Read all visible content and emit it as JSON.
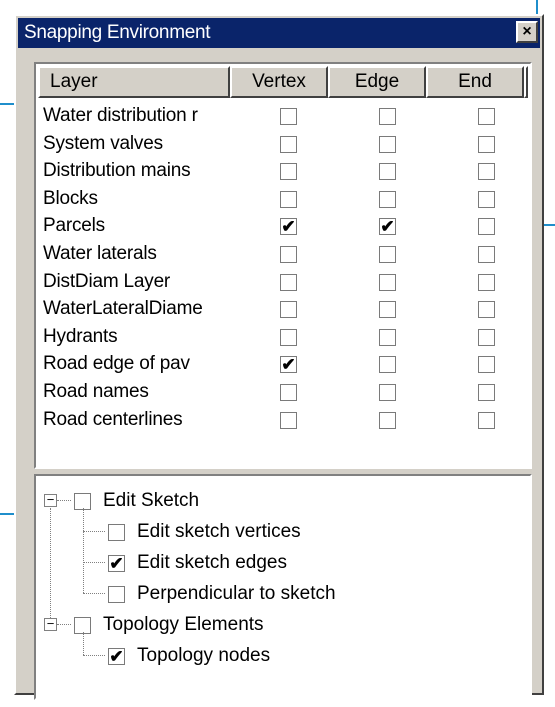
{
  "window": {
    "title": "Snapping Environment",
    "close_label": "×"
  },
  "table": {
    "headers": {
      "layer": "Layer",
      "vertex": "Vertex",
      "edge": "Edge",
      "end": "End"
    },
    "rows": [
      {
        "name": "Water distribution r",
        "vertex": false,
        "edge": false,
        "end": false
      },
      {
        "name": "System valves",
        "vertex": false,
        "edge": false,
        "end": false
      },
      {
        "name": "Distribution mains",
        "vertex": false,
        "edge": false,
        "end": false
      },
      {
        "name": "Blocks",
        "vertex": false,
        "edge": false,
        "end": false
      },
      {
        "name": "Parcels",
        "vertex": true,
        "edge": true,
        "end": false
      },
      {
        "name": "Water laterals",
        "vertex": false,
        "edge": false,
        "end": false
      },
      {
        "name": "DistDiam Layer",
        "vertex": false,
        "edge": false,
        "end": false
      },
      {
        "name": "WaterLateralDiame",
        "vertex": false,
        "edge": false,
        "end": false
      },
      {
        "name": "Hydrants",
        "vertex": false,
        "edge": false,
        "end": false
      },
      {
        "name": "Road  edge of pav",
        "vertex": true,
        "edge": false,
        "end": false
      },
      {
        "name": "Road names",
        "vertex": false,
        "edge": false,
        "end": false
      },
      {
        "name": "Road centerlines",
        "vertex": false,
        "edge": false,
        "end": false
      }
    ]
  },
  "tree": [
    {
      "label": "Edit Sketch",
      "checked": false,
      "expanded": true,
      "expander": "−",
      "children": [
        {
          "label": "Edit sketch vertices",
          "checked": false
        },
        {
          "label": "Edit sketch edges",
          "checked": true
        },
        {
          "label": "Perpendicular to sketch",
          "checked": false
        }
      ]
    },
    {
      "label": "Topology Elements",
      "checked": false,
      "expanded": true,
      "expander": "−",
      "children": [
        {
          "label": "Topology nodes",
          "checked": true
        }
      ]
    }
  ],
  "check_glyph": "✔",
  "colors": {
    "titlebar": "#0a246a",
    "callout": "#1f8ecb",
    "dialog_face": "#d4d0c8"
  }
}
